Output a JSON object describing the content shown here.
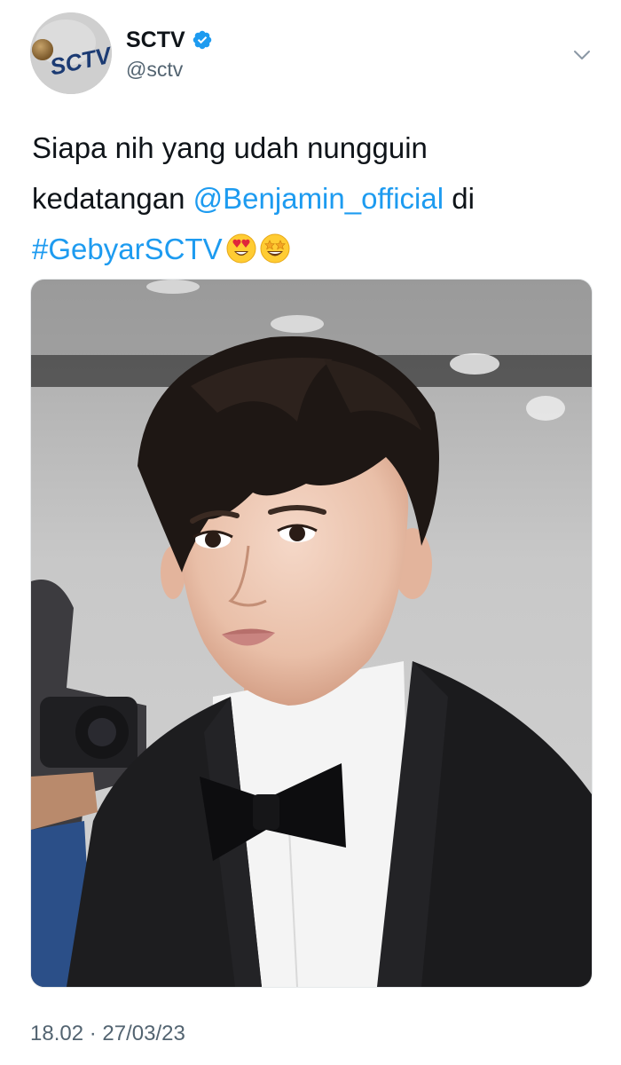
{
  "author": {
    "display_name": "SCTV",
    "handle": "@sctv",
    "verified": true,
    "avatar_logo_text": "SCTV",
    "avatar_icon": "sctv-logo-avatar"
  },
  "tweet": {
    "text_before_mention": "Siapa nih yang udah nungguin kedatangan ",
    "mention": "@Benjamin_official",
    "text_after_mention": " di ",
    "hashtag": "#GebyarSCTV",
    "emojis": [
      "heart-eyes-emoji",
      "star-struck-emoji"
    ],
    "media_image": "photo-man-in-tuxedo-bow-tie",
    "timestamp": "18.02 · 27/03/23"
  },
  "icons": {
    "verified": "verified-badge-icon",
    "more": "chevron-down-icon"
  },
  "colors": {
    "link": "#1d9bf0",
    "verified": "#1d9bf0",
    "secondary_text": "#536471",
    "primary_text": "#0f1419"
  }
}
